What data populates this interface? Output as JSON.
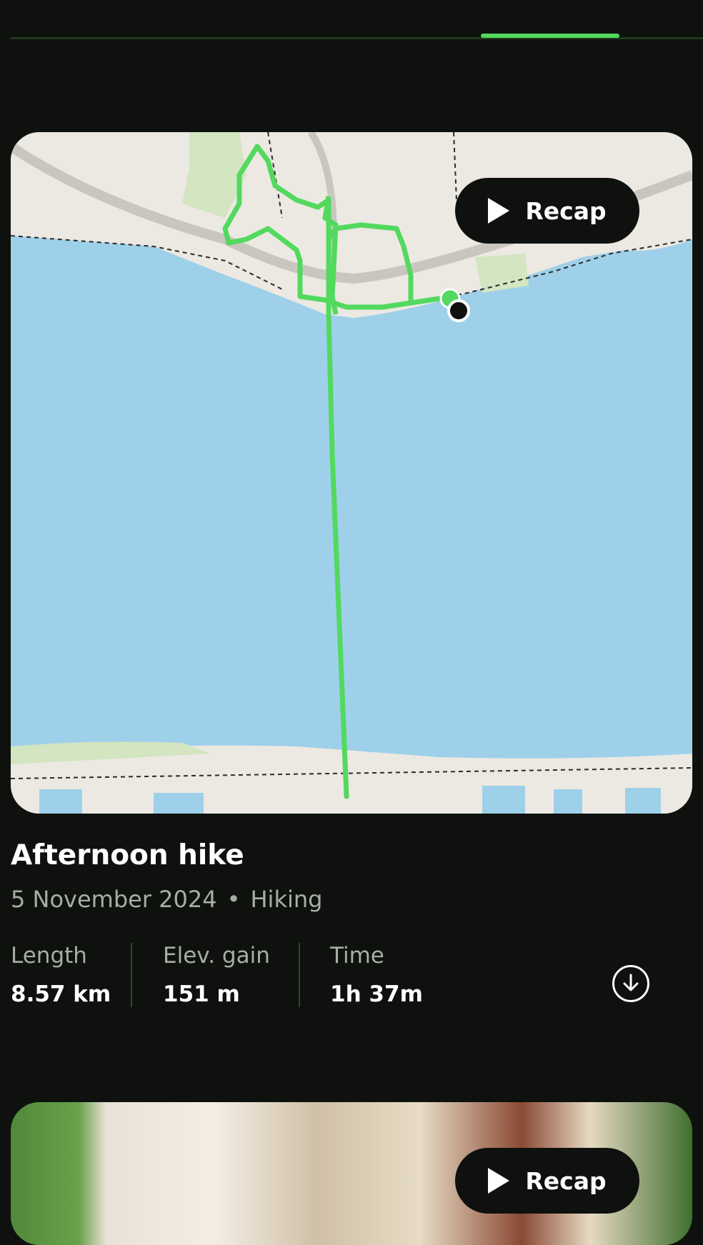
{
  "colors": {
    "background": "#0e110d",
    "accent": "#52d95e",
    "water": "#9fd0ea",
    "land": "#ece9e2",
    "muted_text": "#a9ada7"
  },
  "activity": {
    "title": "Afternoon hike",
    "date": "5 November 2024",
    "separator": "•",
    "type": "Hiking",
    "recap_label": "Recap",
    "stats": [
      {
        "label": "Length",
        "value": "8.57 km"
      },
      {
        "label": "Elev. gain",
        "value": "151 m"
      },
      {
        "label": "Time",
        "value": "1h 37m"
      }
    ]
  },
  "next_card": {
    "recap_label": "Recap"
  },
  "icons": {
    "download": "download-icon",
    "play": "play-icon"
  }
}
